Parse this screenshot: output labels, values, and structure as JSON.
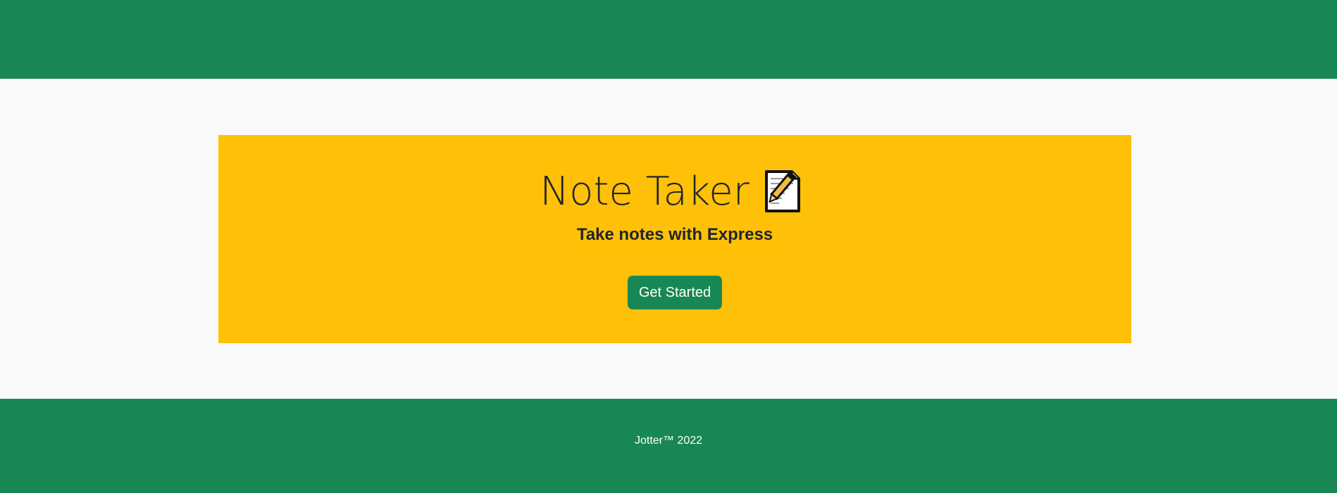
{
  "header": {},
  "hero": {
    "title": "Note Taker",
    "title_icon": "memo-icon",
    "subtitle": "Take notes with Express",
    "cta_label": "Get Started"
  },
  "footer": {
    "text": "Jotter™ 2022"
  },
  "colors": {
    "primary_green": "#198754",
    "hero_yellow": "#ffc107",
    "page_background": "#f8f9fa",
    "text_dark": "#212529"
  }
}
